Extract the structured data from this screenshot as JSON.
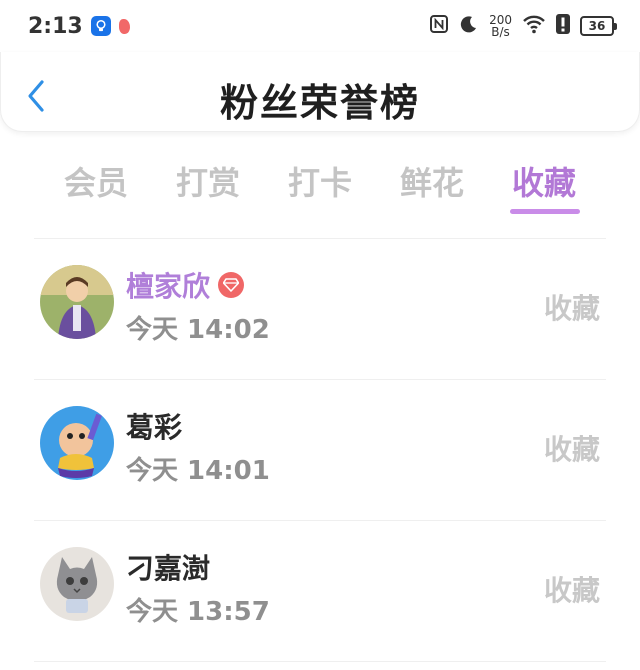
{
  "status_bar": {
    "time": "2:13",
    "net_speed_value": "200",
    "net_speed_unit": "B/s",
    "battery": "36"
  },
  "header": {
    "title": "粉丝荣誉榜"
  },
  "tabs": [
    {
      "label": "会员",
      "active": false
    },
    {
      "label": "打赏",
      "active": false
    },
    {
      "label": "打卡",
      "active": false
    },
    {
      "label": "鲜花",
      "active": false
    },
    {
      "label": "收藏",
      "active": true
    }
  ],
  "list": [
    {
      "name": "檀家欣",
      "badge": "diamond",
      "time": "今天 14:02",
      "action": "收藏"
    },
    {
      "name": "葛彩",
      "time": "今天 14:01",
      "action": "收藏"
    },
    {
      "name": "刁嘉澍",
      "time": "今天 13:57",
      "action": "收藏"
    }
  ],
  "colors": {
    "accent": "#b278d6",
    "indicator": "#c98ce8",
    "vip_name": "#b07fd9",
    "badge": "#f06767",
    "muted": "#c4c4c4"
  }
}
